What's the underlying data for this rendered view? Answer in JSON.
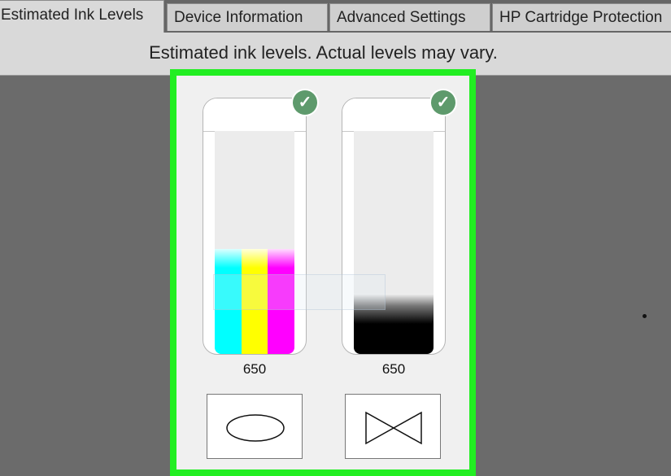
{
  "tabs": [
    {
      "label": "Estimated Ink Levels",
      "active": true
    },
    {
      "label": "Device Information",
      "active": false
    },
    {
      "label": "Advanced Settings",
      "active": false
    },
    {
      "label": "HP Cartridge Protection",
      "active": false
    }
  ],
  "header": {
    "message": "Estimated ink levels.  Actual levels may vary."
  },
  "highlight_color": "#22ee22",
  "cartridges": [
    {
      "name": "tri-color",
      "model": "650",
      "status_icon": "check-icon",
      "status_color": "#5e9a6c",
      "type_icon": "ellipse-icon",
      "levels": {
        "cyan": 0.47,
        "yellow": 0.47,
        "magenta": 0.47
      },
      "colors": {
        "cyan": "#00ffff",
        "yellow": "#ffff00",
        "magenta": "#ff00ff"
      }
    },
    {
      "name": "black",
      "model": "650",
      "status_icon": "check-icon",
      "status_color": "#5e9a6c",
      "type_icon": "bowtie-icon",
      "levels": {
        "black": 0.27
      },
      "colors": {
        "black": "#000000"
      }
    }
  ]
}
